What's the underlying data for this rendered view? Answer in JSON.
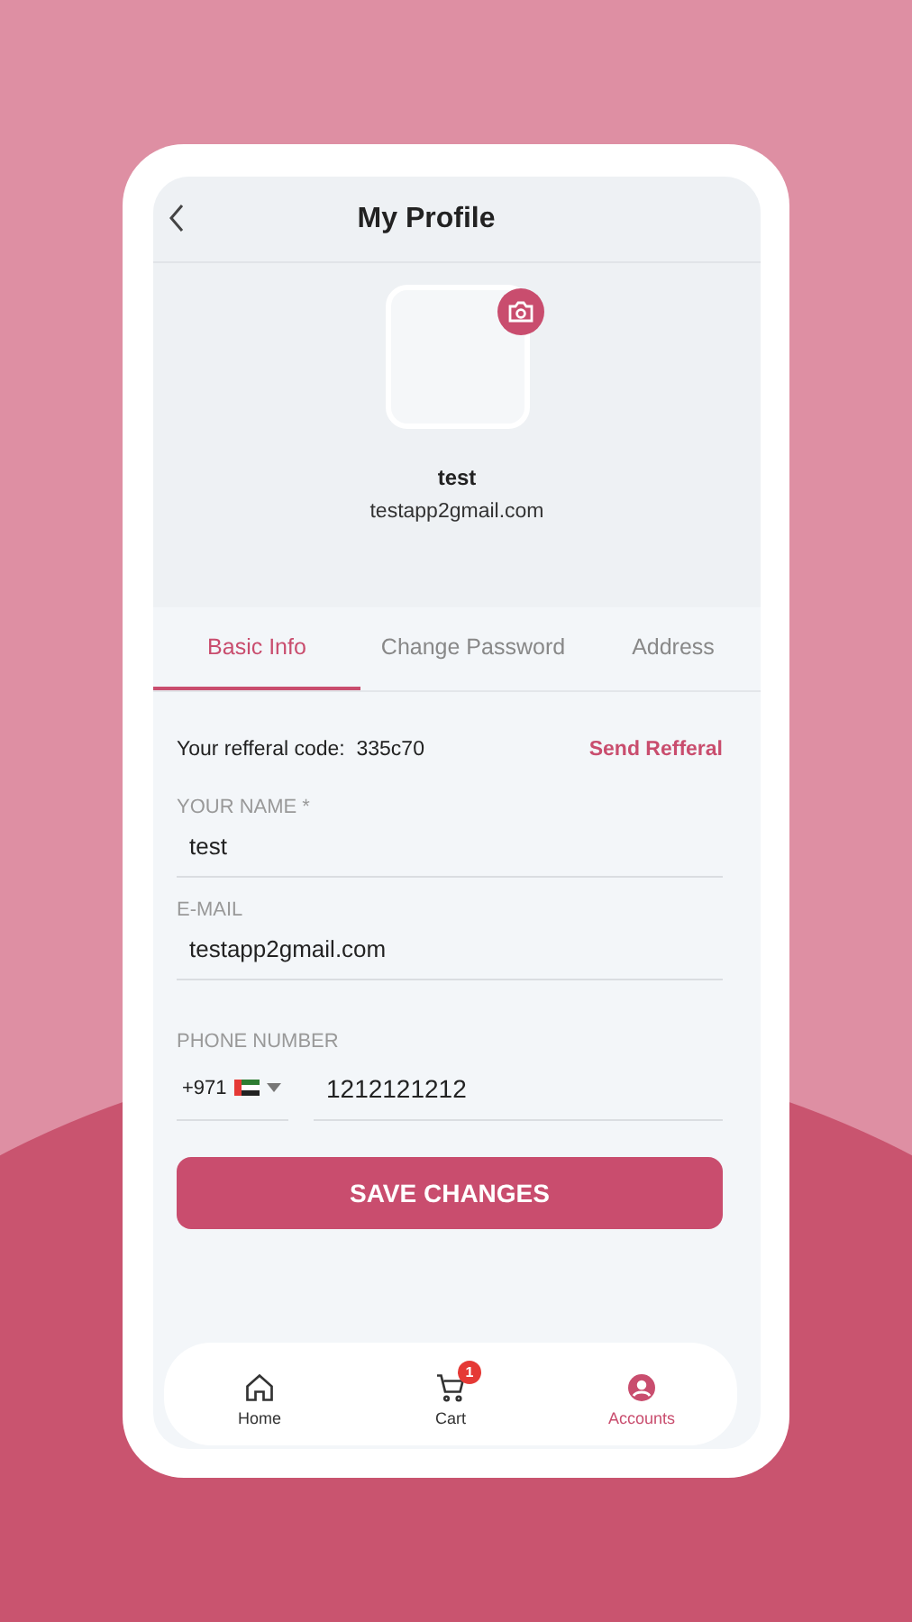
{
  "header": {
    "title": "My Profile"
  },
  "profile": {
    "name": "test",
    "email": "testapp2gmail.com"
  },
  "tabs": [
    {
      "label": "Basic Info",
      "selected": true
    },
    {
      "label": "Change Password",
      "selected": false
    },
    {
      "label": "Address",
      "selected": false
    }
  ],
  "referral": {
    "label": "Your refferal code:",
    "code": "335c70",
    "action": "Send Refferal"
  },
  "fields": [
    {
      "kind": "text",
      "label": "YOUR NAME *",
      "value": "test"
    },
    {
      "kind": "text",
      "label": "E-MAIL",
      "value": "testapp2gmail.com"
    },
    {
      "kind": "phone",
      "label": "PHONE NUMBER",
      "dial_code": "+971",
      "value": "1212121212"
    }
  ],
  "save_button": "SAVE CHANGES",
  "nav": [
    {
      "kind": "home",
      "label": "Home",
      "selected": false
    },
    {
      "kind": "cart",
      "label": "Cart",
      "badge": "1",
      "selected": false
    },
    {
      "kind": "account",
      "label": "Accounts",
      "selected": true
    }
  ]
}
